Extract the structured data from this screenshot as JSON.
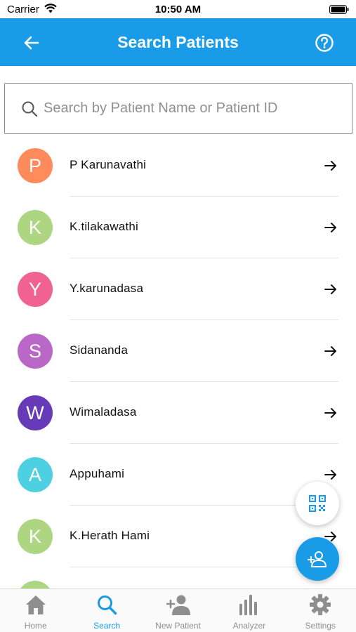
{
  "status_bar": {
    "carrier": "Carrier",
    "time": "10:50 AM"
  },
  "header": {
    "title": "Search Patients"
  },
  "search": {
    "placeholder": "Search by Patient Name or Patient ID",
    "value": ""
  },
  "patients": [
    {
      "initial": "P",
      "name": "P Karunavathi",
      "color": "#ff8a5c"
    },
    {
      "initial": "K",
      "name": "K.tilakawathi",
      "color": "#aed581"
    },
    {
      "initial": "Y",
      "name": "Y.karunadasa",
      "color": "#f06292"
    },
    {
      "initial": "S",
      "name": "Sidananda",
      "color": "#ba68c8"
    },
    {
      "initial": "W",
      "name": "Wimaladasa",
      "color": "#673ab7"
    },
    {
      "initial": "A",
      "name": "Appuhami",
      "color": "#4dd0e1"
    },
    {
      "initial": "K",
      "name": "K.Herath Hami",
      "color": "#aed581"
    },
    {
      "initial": "",
      "name": "",
      "color": "#aed581"
    }
  ],
  "tabs": [
    {
      "label": "Home",
      "icon": "home-icon",
      "active": false
    },
    {
      "label": "Search",
      "icon": "search-icon",
      "active": true
    },
    {
      "label": "New Patient",
      "icon": "add-person-icon",
      "active": false
    },
    {
      "label": "Analyzer",
      "icon": "analyzer-icon",
      "active": false
    },
    {
      "label": "Settings",
      "icon": "gear-icon",
      "active": false
    }
  ],
  "colors": {
    "primary": "#1a9be8",
    "tab_inactive": "#8e8e8e"
  }
}
